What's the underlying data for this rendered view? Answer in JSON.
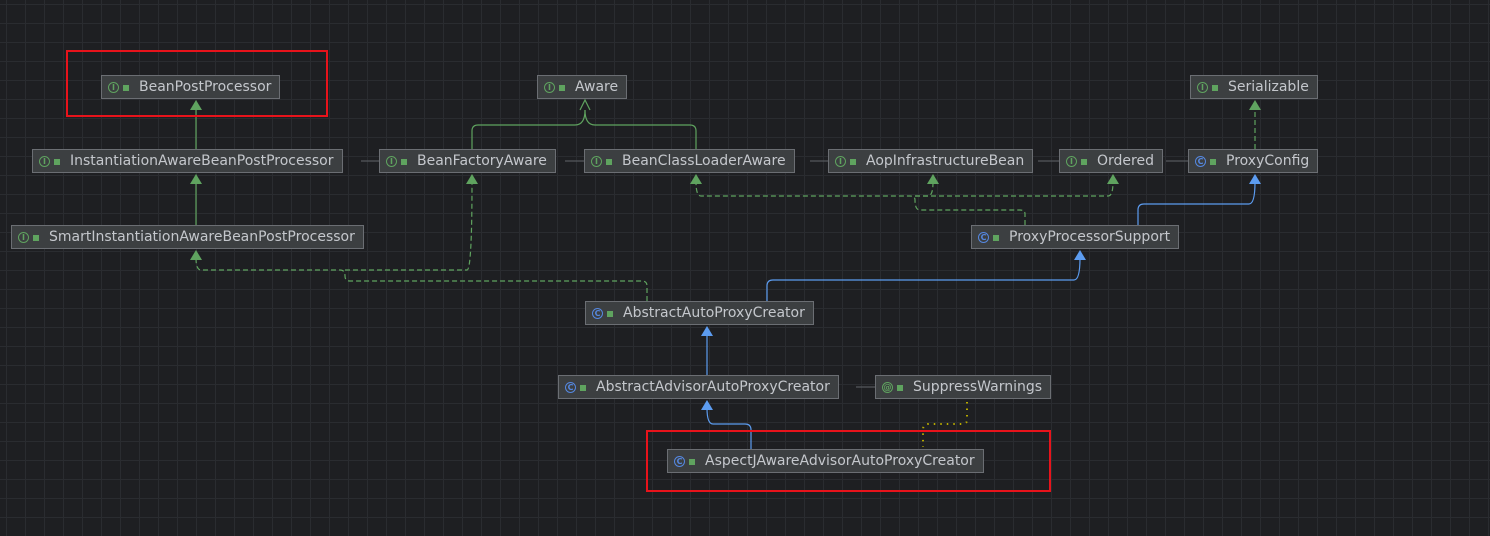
{
  "colors": {
    "interface": "#5fa35f",
    "class": "#5588e0",
    "highlight": "#e8131b",
    "background": "#1e1f22"
  },
  "nodes": [
    {
      "id": "bpp",
      "label": "BeanPostProcessor",
      "kind": "interface"
    },
    {
      "id": "aware",
      "label": "Aware",
      "kind": "interface"
    },
    {
      "id": "serializable",
      "label": "Serializable",
      "kind": "interface"
    },
    {
      "id": "iabpp",
      "label": "InstantiationAwareBeanPostProcessor",
      "kind": "interface"
    },
    {
      "id": "bfa",
      "label": "BeanFactoryAware",
      "kind": "interface"
    },
    {
      "id": "bcla",
      "label": "BeanClassLoaderAware",
      "kind": "interface"
    },
    {
      "id": "aib",
      "label": "AopInfrastructureBean",
      "kind": "interface"
    },
    {
      "id": "ordered",
      "label": "Ordered",
      "kind": "interface"
    },
    {
      "id": "proxyconfig",
      "label": "ProxyConfig",
      "kind": "class"
    },
    {
      "id": "siabpp",
      "label": "SmartInstantiationAwareBeanPostProcessor",
      "kind": "interface"
    },
    {
      "id": "pps",
      "label": "ProxyProcessorSupport",
      "kind": "class"
    },
    {
      "id": "aapc",
      "label": "AbstractAutoProxyCreator",
      "kind": "class"
    },
    {
      "id": "aadvapc",
      "label": "AbstractAdvisorAutoProxyCreator",
      "kind": "class"
    },
    {
      "id": "sw",
      "label": "SuppressWarnings",
      "kind": "annotation"
    },
    {
      "id": "ajaapc",
      "label": "AspectJAwareAdvisorAutoProxyCreator",
      "kind": "class"
    }
  ],
  "kind_glyphs": {
    "interface": "I",
    "class": "C",
    "annotation": "@"
  }
}
